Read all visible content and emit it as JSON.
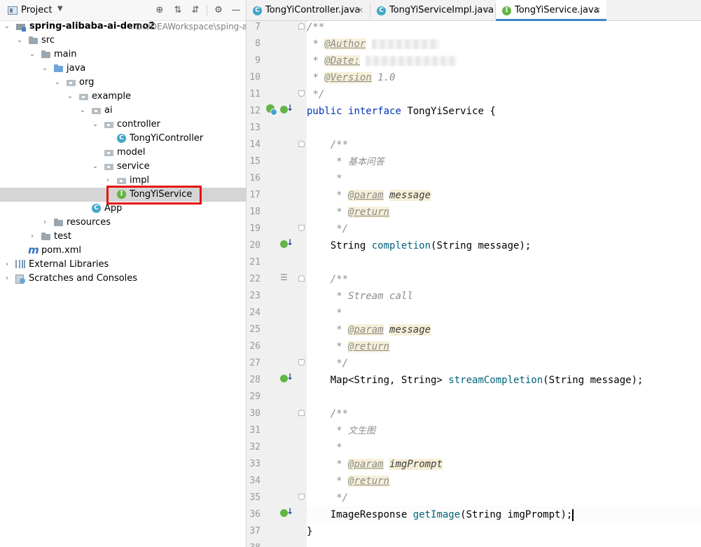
{
  "project_header": {
    "title": "Project"
  },
  "tree": [
    {
      "label": "spring-alibaba-ai-demo2",
      "suffix": "D:\\IDEAWorkspace\\sping-a",
      "icon": "module-folder-icon",
      "arrow": "expanded"
    },
    {
      "label": "src",
      "icon": "folder-icon",
      "arrow": "expanded"
    },
    {
      "label": "main",
      "icon": "folder-icon",
      "arrow": "expanded"
    },
    {
      "label": "java",
      "icon": "source-folder-icon",
      "arrow": "expanded"
    },
    {
      "label": "org",
      "icon": "package-icon",
      "arrow": "expanded"
    },
    {
      "label": "example",
      "icon": "package-icon",
      "arrow": "expanded"
    },
    {
      "label": "ai",
      "icon": "package-icon",
      "arrow": "expanded"
    },
    {
      "label": "controller",
      "icon": "package-icon",
      "arrow": "expanded"
    },
    {
      "label": "TongYiController",
      "icon": "class-icon",
      "arrow": "none"
    },
    {
      "label": "model",
      "icon": "package-icon",
      "arrow": "none"
    },
    {
      "label": "service",
      "icon": "package-icon",
      "arrow": "expanded"
    },
    {
      "label": "impl",
      "icon": "package-icon",
      "arrow": "collapsed"
    },
    {
      "label": "TongYiService",
      "icon": "interface-icon",
      "arrow": "none",
      "selected": true
    },
    {
      "label": "App",
      "icon": "class-icon",
      "arrow": "none"
    },
    {
      "label": "resources",
      "icon": "resources-folder-icon",
      "arrow": "collapsed"
    },
    {
      "label": "test",
      "icon": "folder-icon",
      "arrow": "collapsed"
    },
    {
      "label": "pom.xml",
      "icon": "maven-icon",
      "arrow": "none"
    },
    {
      "label": "External Libraries",
      "icon": "libraries-icon",
      "arrow": "collapsed"
    },
    {
      "label": "Scratches and Consoles",
      "icon": "scratches-icon",
      "arrow": "collapsed"
    }
  ],
  "tabs": [
    {
      "label": "TongYiController.java",
      "icon": "class-icon",
      "active": false
    },
    {
      "label": "TongYiServiceImpl.java",
      "icon": "class-icon",
      "active": false
    },
    {
      "label": "TongYiService.java",
      "icon": "interface-icon",
      "active": true
    }
  ],
  "icons": {
    "class_letter": "C",
    "interface_letter": "I",
    "maven_letter": "m"
  },
  "code": {
    "line_numbers": [
      "7",
      "8",
      "9",
      "10",
      "11",
      "12",
      "13",
      "14",
      "15",
      "16",
      "17",
      "18",
      "19",
      "20",
      "21",
      "22",
      "23",
      "24",
      "25",
      "26",
      "27",
      "28",
      "29",
      "30",
      "31",
      "32",
      "33",
      "34",
      "35",
      "36",
      "37",
      "38"
    ],
    "l7": "/**",
    "author_tag": "@Author",
    "date_tag": "@Date:",
    "version_tag": "@Version",
    "version_value": "1.0",
    "doc_close": "*/",
    "doc_star": "*",
    "doc_open": "/**",
    "kw_public": "public",
    "kw_interface": "interface",
    "interface_name": "TongYiService",
    "brace_open": "{",
    "brace_close": "}",
    "m1_desc": "基本问答",
    "param_tag": "@param",
    "return_tag": "@return",
    "m1_param": "message",
    "m1_sig_type": "String ",
    "m1_name": "completion",
    "m1_args": "(String message);",
    "m2_desc": "Stream call",
    "m2_param": "message",
    "m2_sig_type": "Map<String, String> ",
    "m2_name": "streamCompletion",
    "m2_args": "(String message);",
    "m3_desc": "文生图",
    "m3_param": "imgPrompt",
    "m3_sig_type": "ImageResponse ",
    "m3_name": "getImage",
    "m3_args": "(String imgPrompt);"
  },
  "colors": {
    "keyword": "#0033b3",
    "method": "#00627a",
    "comment": "#8c8c8c",
    "selection_box": "#e8120c",
    "active_tab_underline": "#4083c9"
  }
}
